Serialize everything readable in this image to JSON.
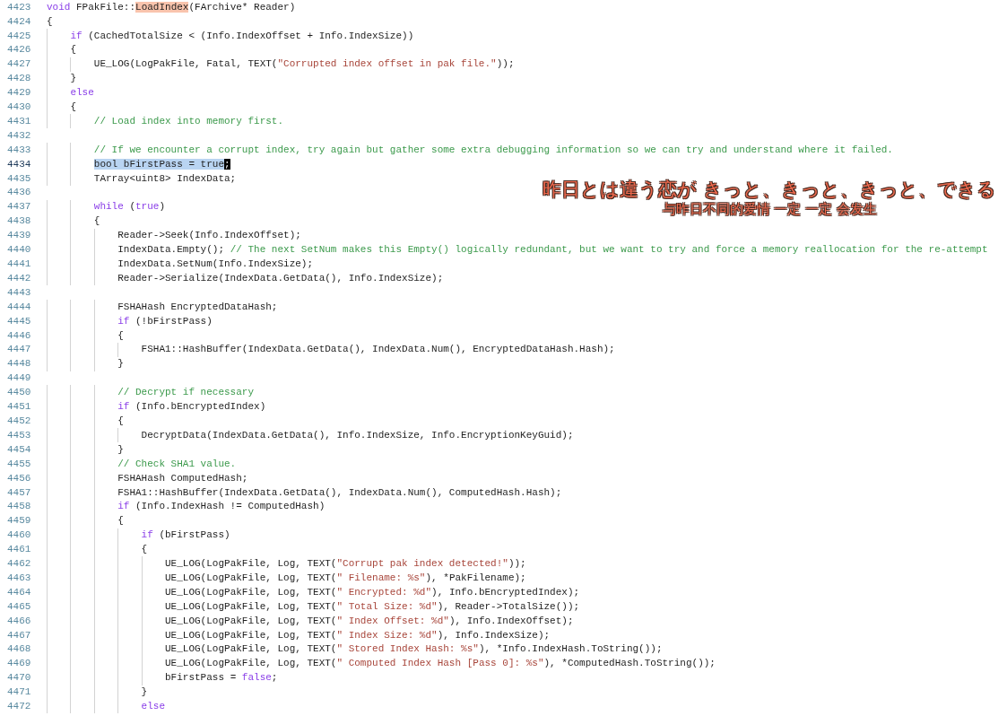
{
  "editor": {
    "lines": [
      {
        "number": "4423",
        "current": false,
        "tokens": [
          {
            "kind": "keyword",
            "text": "void"
          },
          {
            "kind": "plain",
            "text": " FPakFile::"
          },
          {
            "kind": "match",
            "text": "LoadIndex"
          },
          {
            "kind": "plain",
            "text": "(FArchive* Reader)"
          }
        ]
      },
      {
        "number": "4424",
        "current": false,
        "tokens": [
          {
            "kind": "plain",
            "text": "{"
          }
        ]
      },
      {
        "number": "4425",
        "current": false,
        "tokens": [
          {
            "kind": "keyword",
            "text": "    if"
          },
          {
            "kind": "plain",
            "text": " (CachedTotalSize < (Info.IndexOffset + Info.IndexSize))"
          }
        ]
      },
      {
        "number": "4426",
        "current": false,
        "tokens": [
          {
            "kind": "plain",
            "text": "    {"
          }
        ]
      },
      {
        "number": "4427",
        "current": false,
        "tokens": [
          {
            "kind": "plain",
            "text": "        UE_LOG(LogPakFile, Fatal, TEXT("
          },
          {
            "kind": "string",
            "text": "\"Corrupted index offset in pak file.\""
          },
          {
            "kind": "plain",
            "text": "));"
          }
        ]
      },
      {
        "number": "4428",
        "current": false,
        "tokens": [
          {
            "kind": "plain",
            "text": "    }"
          }
        ]
      },
      {
        "number": "4429",
        "current": false,
        "tokens": [
          {
            "kind": "keyword",
            "text": "    else"
          }
        ]
      },
      {
        "number": "4430",
        "current": false,
        "tokens": [
          {
            "kind": "plain",
            "text": "    {"
          }
        ]
      },
      {
        "number": "4431",
        "current": false,
        "tokens": [
          {
            "kind": "comment",
            "text": "        // Load index into memory first."
          }
        ]
      },
      {
        "number": "4432",
        "current": false
      },
      {
        "number": "4433",
        "current": false,
        "tokens": [
          {
            "kind": "comment",
            "text": "        // If we encounter a corrupt index, try again but gather some extra debugging information so we can try and understand where it failed."
          }
        ]
      },
      {
        "number": "4434",
        "current": true,
        "tokens": [
          {
            "kind": "selection",
            "text": "        bool bFirstPass = true"
          },
          {
            "kind": "cursor",
            "text": ";"
          }
        ]
      },
      {
        "number": "4435",
        "current": false,
        "tokens": [
          {
            "kind": "plain",
            "text": "        TArray<uint8> IndexData;"
          }
        ]
      },
      {
        "number": "4436",
        "current": false
      },
      {
        "number": "4437",
        "current": false,
        "tokens": [
          {
            "kind": "keyword",
            "text": "        while"
          },
          {
            "kind": "plain",
            "text": " ("
          },
          {
            "kind": "keyword",
            "text": "true"
          },
          {
            "kind": "plain",
            "text": ")"
          }
        ]
      },
      {
        "number": "4438",
        "current": false,
        "tokens": [
          {
            "kind": "plain",
            "text": "        {"
          }
        ]
      },
      {
        "number": "4439",
        "current": false,
        "tokens": [
          {
            "kind": "plain",
            "text": "            Reader->Seek(Info.IndexOffset);"
          }
        ]
      },
      {
        "number": "4440",
        "current": false,
        "tokens": [
          {
            "kind": "plain",
            "text": "            IndexData.Empty(); "
          },
          {
            "kind": "comment",
            "text": "// The next SetNum makes this Empty() logically redundant, but we want to try and force a memory reallocation for the re-attempt"
          }
        ]
      },
      {
        "number": "4441",
        "current": false,
        "tokens": [
          {
            "kind": "plain",
            "text": "            IndexData.SetNum(Info.IndexSize);"
          }
        ]
      },
      {
        "number": "4442",
        "current": false,
        "tokens": [
          {
            "kind": "plain",
            "text": "            Reader->Serialize(IndexData.GetData(), Info.IndexSize);"
          }
        ]
      },
      {
        "number": "4443",
        "current": false
      },
      {
        "number": "4444",
        "current": false,
        "tokens": [
          {
            "kind": "plain",
            "text": "            FSHAHash EncryptedDataHash;"
          }
        ]
      },
      {
        "number": "4445",
        "current": false,
        "tokens": [
          {
            "kind": "keyword",
            "text": "            if"
          },
          {
            "kind": "plain",
            "text": " (!bFirstPass)"
          }
        ]
      },
      {
        "number": "4446",
        "current": false,
        "tokens": [
          {
            "kind": "plain",
            "text": "            {"
          }
        ]
      },
      {
        "number": "4447",
        "current": false,
        "tokens": [
          {
            "kind": "plain",
            "text": "                FSHA1::HashBuffer(IndexData.GetData(), IndexData.Num(), EncryptedDataHash.Hash);"
          }
        ]
      },
      {
        "number": "4448",
        "current": false,
        "tokens": [
          {
            "kind": "plain",
            "text": "            }"
          }
        ]
      },
      {
        "number": "4449",
        "current": false
      },
      {
        "number": "4450",
        "current": false,
        "tokens": [
          {
            "kind": "comment",
            "text": "            // Decrypt if necessary"
          }
        ]
      },
      {
        "number": "4451",
        "current": false,
        "tokens": [
          {
            "kind": "keyword",
            "text": "            if"
          },
          {
            "kind": "plain",
            "text": " (Info.bEncryptedIndex)"
          }
        ]
      },
      {
        "number": "4452",
        "current": false,
        "tokens": [
          {
            "kind": "plain",
            "text": "            {"
          }
        ]
      },
      {
        "number": "4453",
        "current": false,
        "tokens": [
          {
            "kind": "plain",
            "text": "                DecryptData(IndexData.GetData(), Info.IndexSize, Info.EncryptionKeyGuid);"
          }
        ]
      },
      {
        "number": "4454",
        "current": false,
        "tokens": [
          {
            "kind": "plain",
            "text": "            }"
          }
        ]
      },
      {
        "number": "4455",
        "current": false,
        "tokens": [
          {
            "kind": "comment",
            "text": "            // Check SHA1 value."
          }
        ]
      },
      {
        "number": "4456",
        "current": false,
        "tokens": [
          {
            "kind": "plain",
            "text": "            FSHAHash ComputedHash;"
          }
        ]
      },
      {
        "number": "4457",
        "current": false,
        "tokens": [
          {
            "kind": "plain",
            "text": "            FSHA1::HashBuffer(IndexData.GetData(), IndexData.Num(), ComputedHash.Hash);"
          }
        ]
      },
      {
        "number": "4458",
        "current": false,
        "tokens": [
          {
            "kind": "keyword",
            "text": "            if"
          },
          {
            "kind": "plain",
            "text": " (Info.IndexHash != ComputedHash)"
          }
        ]
      },
      {
        "number": "4459",
        "current": false,
        "tokens": [
          {
            "kind": "plain",
            "text": "            {"
          }
        ]
      },
      {
        "number": "4460",
        "current": false,
        "tokens": [
          {
            "kind": "keyword",
            "text": "                if"
          },
          {
            "kind": "plain",
            "text": " (bFirstPass)"
          }
        ]
      },
      {
        "number": "4461",
        "current": false,
        "tokens": [
          {
            "kind": "plain",
            "text": "                {"
          }
        ]
      },
      {
        "number": "4462",
        "current": false,
        "tokens": [
          {
            "kind": "plain",
            "text": "                    UE_LOG(LogPakFile, Log, TEXT("
          },
          {
            "kind": "string",
            "text": "\"Corrupt pak index detected!\""
          },
          {
            "kind": "plain",
            "text": "));"
          }
        ]
      },
      {
        "number": "4463",
        "current": false,
        "tokens": [
          {
            "kind": "plain",
            "text": "                    UE_LOG(LogPakFile, Log, TEXT("
          },
          {
            "kind": "string",
            "text": "\" Filename: %s\""
          },
          {
            "kind": "plain",
            "text": "), *PakFilename);"
          }
        ]
      },
      {
        "number": "4464",
        "current": false,
        "tokens": [
          {
            "kind": "plain",
            "text": "                    UE_LOG(LogPakFile, Log, TEXT("
          },
          {
            "kind": "string",
            "text": "\" Encrypted: %d\""
          },
          {
            "kind": "plain",
            "text": "), Info.bEncryptedIndex);"
          }
        ]
      },
      {
        "number": "4465",
        "current": false,
        "tokens": [
          {
            "kind": "plain",
            "text": "                    UE_LOG(LogPakFile, Log, TEXT("
          },
          {
            "kind": "string",
            "text": "\" Total Size: %d\""
          },
          {
            "kind": "plain",
            "text": "), Reader->TotalSize());"
          }
        ]
      },
      {
        "number": "4466",
        "current": false,
        "tokens": [
          {
            "kind": "plain",
            "text": "                    UE_LOG(LogPakFile, Log, TEXT("
          },
          {
            "kind": "string",
            "text": "\" Index Offset: %d\""
          },
          {
            "kind": "plain",
            "text": "), Info.IndexOffset);"
          }
        ]
      },
      {
        "number": "4467",
        "current": false,
        "tokens": [
          {
            "kind": "plain",
            "text": "                    UE_LOG(LogPakFile, Log, TEXT("
          },
          {
            "kind": "string",
            "text": "\" Index Size: %d\""
          },
          {
            "kind": "plain",
            "text": "), Info.IndexSize);"
          }
        ]
      },
      {
        "number": "4468",
        "current": false,
        "tokens": [
          {
            "kind": "plain",
            "text": "                    UE_LOG(LogPakFile, Log, TEXT("
          },
          {
            "kind": "string",
            "text": "\" Stored Index Hash: %s\""
          },
          {
            "kind": "plain",
            "text": "), *Info.IndexHash.ToString());"
          }
        ]
      },
      {
        "number": "4469",
        "current": false,
        "tokens": [
          {
            "kind": "plain",
            "text": "                    UE_LOG(LogPakFile, Log, TEXT("
          },
          {
            "kind": "string",
            "text": "\" Computed Index Hash [Pass 0]: %s\""
          },
          {
            "kind": "plain",
            "text": "), *ComputedHash.ToString());"
          }
        ]
      },
      {
        "number": "4470",
        "current": false,
        "tokens": [
          {
            "kind": "plain",
            "text": "                    bFirstPass = "
          },
          {
            "kind": "keyword",
            "text": "false"
          },
          {
            "kind": "plain",
            "text": ";"
          }
        ]
      },
      {
        "number": "4471",
        "current": false,
        "tokens": [
          {
            "kind": "plain",
            "text": "                }"
          }
        ]
      },
      {
        "number": "4472",
        "current": false,
        "tokens": [
          {
            "kind": "keyword",
            "text": "                else"
          }
        ]
      }
    ]
  },
  "subtitles": {
    "japanese": "昨日とは違う恋が きっと、きっと、きっと、できる",
    "chinese": "与昨日不同的爱情 一定 一定 会发生"
  }
}
